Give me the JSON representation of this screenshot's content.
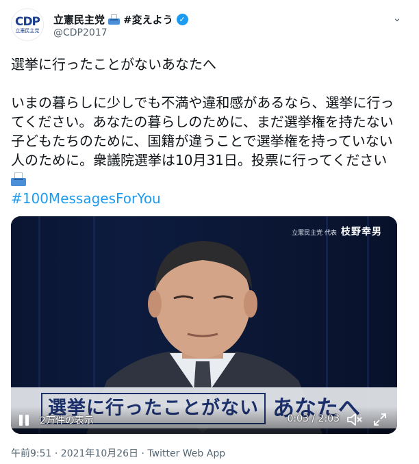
{
  "account": {
    "display_name": "立憲民主党",
    "campaign": "#変えよう",
    "handle": "@CDP2017",
    "logo_mark": "CDP",
    "logo_text": "立憲民主党"
  },
  "tweet": {
    "line1": "選挙に行ったことがないあなたへ",
    "paragraph": "いまの暮らしに少しでも不満や違和感があるなら、選挙に行ってください。あなたの暮らしのために、まだ選挙権を持たない子どもたちのために、国籍が違うことで選挙権を持っていない人のために。衆議院選挙は10月31日。投票に行ってください",
    "hashtag": "#100MessagesForYou"
  },
  "video": {
    "speaker_org": "立憲民主党 代表",
    "speaker_name": "枝野幸男",
    "subtitle_main": "選挙に行ったことがない",
    "subtitle_tail": "あなたへ",
    "views": "2万件の表示",
    "time": "0:03 / 2:03",
    "playback_progress": 0.024
  },
  "footer": {
    "timestamp": "午前9:51 · 2021年10月26日 · Twitter Web App"
  },
  "colors": {
    "accent": "#1d9bf0",
    "text": "#0f1419",
    "muted": "#536471",
    "subtitle": "#1b2f6b"
  },
  "icons": [
    "ballot-box-icon",
    "verified-icon",
    "more-icon",
    "pause-icon",
    "mute-icon",
    "fullscreen-icon"
  ]
}
